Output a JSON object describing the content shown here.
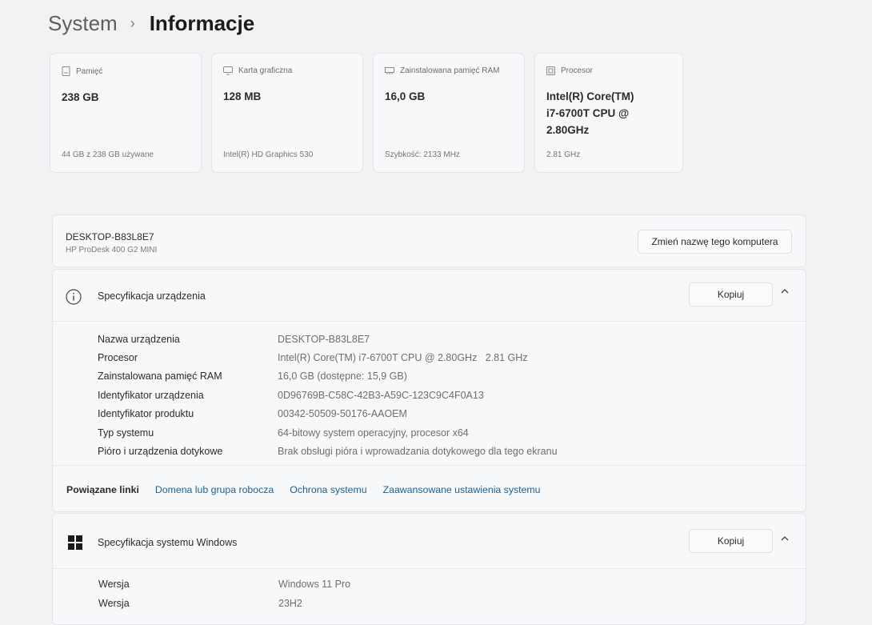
{
  "breadcrumb": {
    "parent": "System",
    "separator": "›",
    "current": "Informacje"
  },
  "tiles": [
    {
      "icon": "storage-icon",
      "label": "Pamięć",
      "value": "238 GB",
      "sub": "44 GB z 238 GB używane"
    },
    {
      "icon": "display-adapter-icon",
      "label": "Karta graficzna",
      "value": "128 MB",
      "sub": "Intel(R) HD Graphics 530"
    },
    {
      "icon": "ram-icon",
      "label": "Zainstalowana pamięć RAM",
      "value": "16,0 GB",
      "sub": "Szybkość: 2133 MHz"
    },
    {
      "icon": "processor-icon",
      "label": "Procesor",
      "value_lines": [
        "Intel(R) Core(TM)",
        "i7-6700T CPU @",
        "2.80GHz"
      ],
      "sub": "2.81 GHz"
    }
  ],
  "device": {
    "name": "DESKTOP-B83L8E7",
    "model": "HP ProDesk 400 G2 MINI",
    "rename_button": "Zmień nazwę tego komputera"
  },
  "device_specs": {
    "title": "Specyfikacja urządzenia",
    "copy_button": "Kopiuj",
    "rows": [
      {
        "key": "Nazwa urządzenia",
        "value": "DESKTOP-B83L8E7"
      },
      {
        "key": "Procesor",
        "value": "Intel(R) Core(TM) i7-6700T CPU @ 2.80GHz   2.81 GHz"
      },
      {
        "key": "Zainstalowana pamięć RAM",
        "value": "16,0 GB (dostępne: 15,9 GB)"
      },
      {
        "key": "Identyfikator urządzenia",
        "value": "0D96769B-C58C-42B3-A59C-123C9C4F0A13"
      },
      {
        "key": "Identyfikator produktu",
        "value": "00342-50509-50176-AAOEM"
      },
      {
        "key": "Typ systemu",
        "value": "64-bitowy system operacyjny, procesor x64"
      },
      {
        "key": "Pióro i urządzenia dotykowe",
        "value": "Brak obsługi pióra i wprowadzania dotykowego dla tego ekranu"
      }
    ]
  },
  "related_links": {
    "label": "Powiązane linki",
    "links": [
      "Domena lub grupa robocza",
      "Ochrona systemu",
      "Zaawansowane ustawienia systemu"
    ]
  },
  "windows_specs": {
    "title": "Specyfikacja systemu Windows",
    "copy_button": "Kopiuj",
    "rows": [
      {
        "key": "Wersja",
        "value": "Windows 11 Pro"
      },
      {
        "key": "Wersja",
        "value": "23H2"
      }
    ]
  },
  "colors": {
    "background": "#f0f2f4",
    "card": "#f7f8f9",
    "link": "#1f5f8f"
  }
}
